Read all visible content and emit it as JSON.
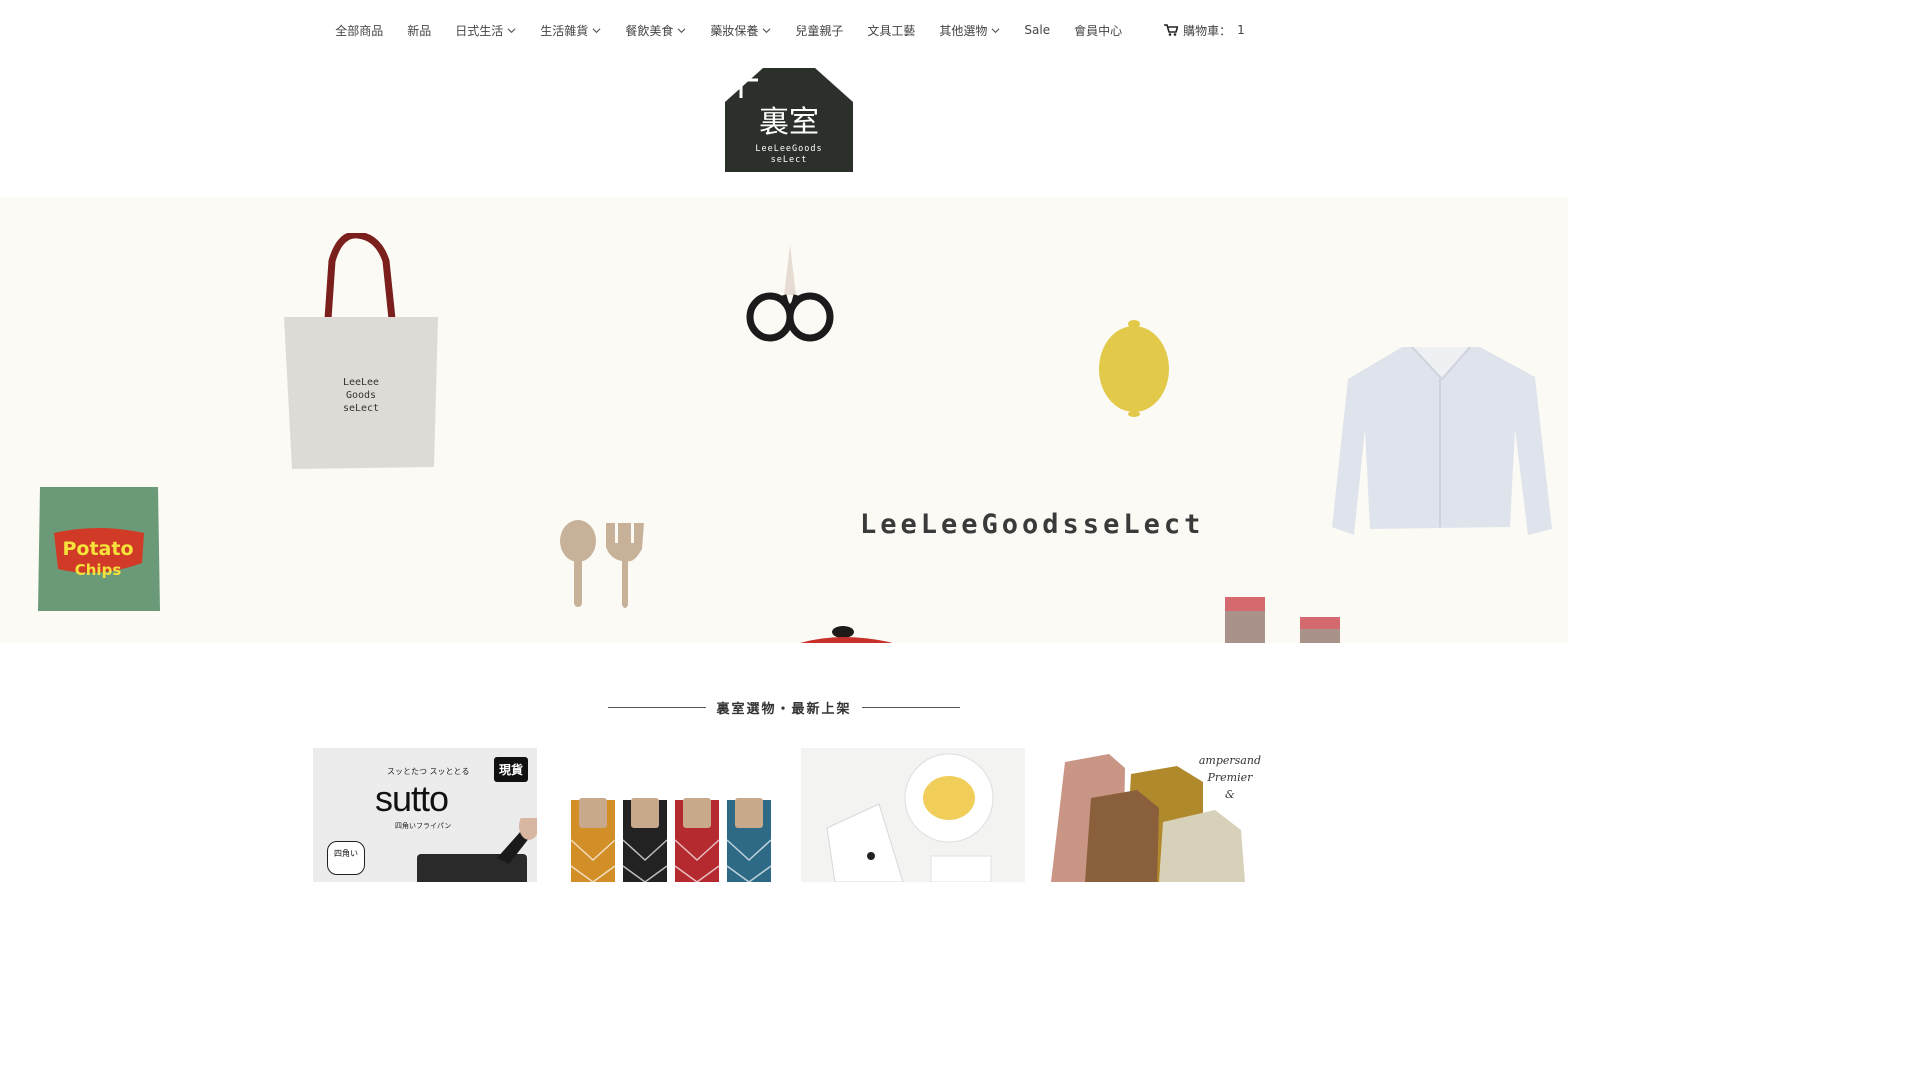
{
  "nav": {
    "items": [
      {
        "label": "全部商品",
        "has_dropdown": false
      },
      {
        "label": "新品",
        "has_dropdown": false
      },
      {
        "label": "日式生活",
        "has_dropdown": true
      },
      {
        "label": "生活雜貨",
        "has_dropdown": true
      },
      {
        "label": "餐飲美食",
        "has_dropdown": true
      },
      {
        "label": "藥妝保養",
        "has_dropdown": true
      },
      {
        "label": "兒童親子",
        "has_dropdown": false
      },
      {
        "label": "文具工藝",
        "has_dropdown": false
      },
      {
        "label": "其他選物",
        "has_dropdown": true
      },
      {
        "label": "Sale",
        "has_dropdown": false
      },
      {
        "label": "會員中心",
        "has_dropdown": false
      }
    ],
    "cart": {
      "label": "購物車：",
      "count": "1"
    }
  },
  "logo": {
    "chars": "裏室",
    "line1": "LeeLeeGoods",
    "line2": "seLect",
    "color": "#2b302a"
  },
  "hero": {
    "background": "#fcfaf5",
    "brand_text": "LeeLeeGoodsseLect",
    "bag_text": [
      "LeeLee",
      "Goods",
      "seLect"
    ],
    "chips_text": [
      "Potato",
      "Chips"
    ]
  },
  "section": {
    "title": "裏室選物・最新上架"
  },
  "products": [
    {
      "name": "sutto",
      "badge": "現貨",
      "tagline": "スッとたつ スッととる",
      "title": "sutto",
      "subtitle": "四角いフライパン",
      "bubble": "四角い"
    },
    {
      "name": "socks"
    },
    {
      "name": "potato-chips"
    },
    {
      "name": "ampersand",
      "brand_lines": [
        "ampersand",
        "Premier",
        "&"
      ]
    }
  ]
}
